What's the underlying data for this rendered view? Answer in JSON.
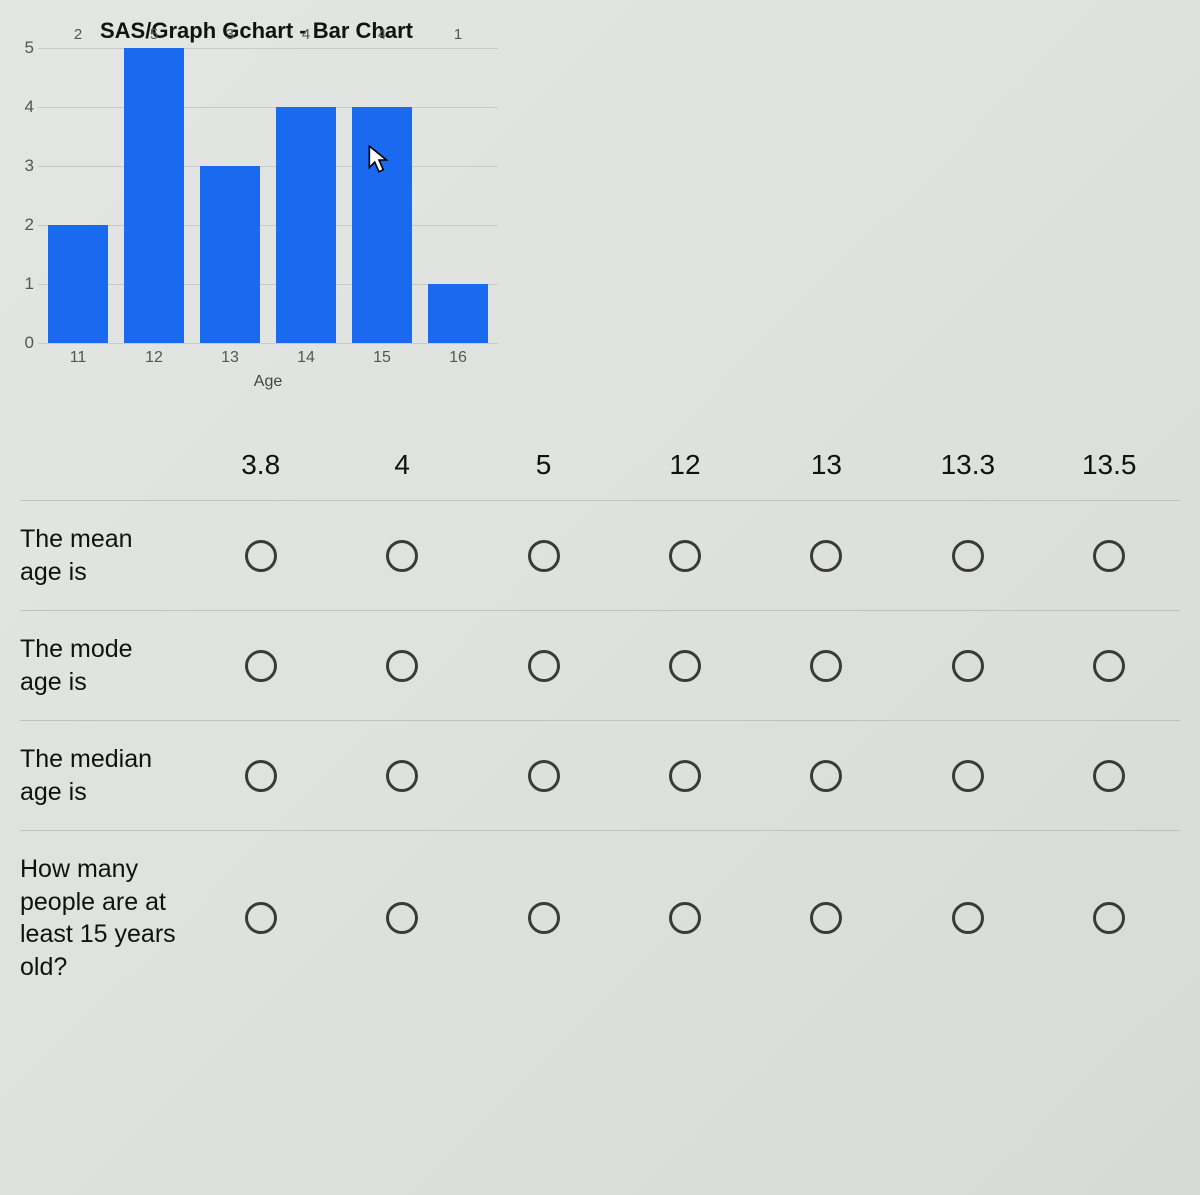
{
  "chart_data": {
    "type": "bar",
    "title": "SAS/Graph Gchart - Bar Chart",
    "xlabel": "Age",
    "ylabel": "",
    "categories": [
      "11",
      "12",
      "13",
      "14",
      "15",
      "16"
    ],
    "values": [
      2,
      5,
      3,
      4,
      4,
      1
    ],
    "ylim": [
      0,
      5
    ],
    "yticks": [
      0,
      1,
      2,
      3,
      4,
      5
    ]
  },
  "matrix": {
    "columns": [
      "3.8",
      "4",
      "5",
      "12",
      "13",
      "13.3",
      "13.5"
    ],
    "rows": [
      {
        "label": "The mean age is"
      },
      {
        "label": "The mode age is"
      },
      {
        "label": "The median age is"
      },
      {
        "label": "How many people are at least 15 years old?"
      }
    ]
  }
}
